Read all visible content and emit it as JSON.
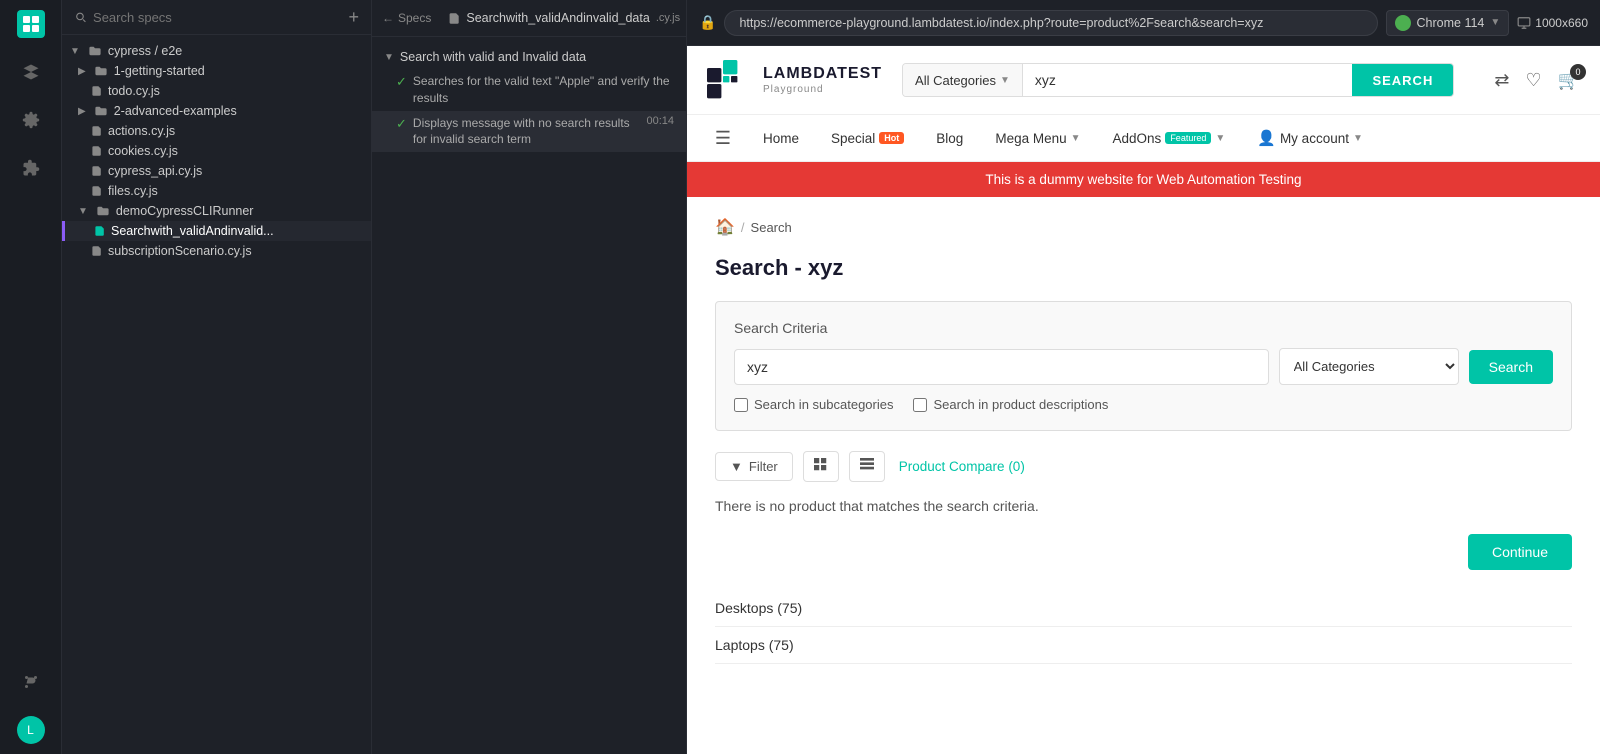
{
  "app": {
    "title": "Search specs"
  },
  "sidebar": {
    "logo_color": "#00c4a7",
    "icons": [
      "grid",
      "layers",
      "settings-cog",
      "settings-cog2"
    ]
  },
  "file_panel": {
    "search_placeholder": "Search specs",
    "tree": {
      "root_folder": "cypress / e2e",
      "folders": [
        {
          "name": "1-getting-started",
          "indent": 1,
          "files": [
            {
              "name": "todo.cy.js",
              "indent": 2
            }
          ]
        },
        {
          "name": "2-advanced-examples",
          "indent": 1,
          "files": [
            {
              "name": "actions.cy.js",
              "indent": 2
            },
            {
              "name": "cookies.cy.js",
              "indent": 2
            },
            {
              "name": "cypress_api.cy.js",
              "indent": 2
            },
            {
              "name": "files.cy.js",
              "indent": 2
            }
          ]
        },
        {
          "name": "demoCypressCLIRunner",
          "indent": 1,
          "files": [
            {
              "name": "Searchwith_validAndinvalid...",
              "indent": 2,
              "active": true
            },
            {
              "name": "subscriptionScenario.cy.js",
              "indent": 2
            }
          ]
        }
      ]
    }
  },
  "spec_panel": {
    "back_label": "Specs",
    "filename": "Searchwith_validAndinvalid_data",
    "extension": ".cy.js",
    "time": "00:14",
    "pass_count": "2",
    "fail_count": "",
    "load_indicator": "○",
    "groups": [
      {
        "name": "Search with valid and Invalid data",
        "tests": [
          {
            "name": "Searches for the valid text \"Apple\" and verify the results",
            "status": "pass"
          },
          {
            "name": "Displays message with no search results for invalid search term",
            "status": "pass",
            "highlighted": true
          }
        ]
      }
    ]
  },
  "browser": {
    "url": "https://ecommerce-playground.lambdatest.io/index.php?route=product%2Fsearch&search=xyz",
    "engine": "Chrome 114",
    "viewport": "1000x660",
    "security_icon": "🔒"
  },
  "website": {
    "logo_brand": "LAMBDATEST",
    "logo_sub": "Playground",
    "search_category": "All Categories",
    "search_value": "xyz",
    "search_button": "SEARCH",
    "nav_items": [
      {
        "label": "Home",
        "badge": null
      },
      {
        "label": "Special",
        "badge": "Hot"
      },
      {
        "label": "Blog",
        "badge": null
      },
      {
        "label": "Mega Menu",
        "badge": null,
        "dropdown": true
      },
      {
        "label": "AddOns",
        "badge": "Featured",
        "dropdown": true
      },
      {
        "label": "My account",
        "badge": null,
        "dropdown": true,
        "icon": "person"
      }
    ],
    "banner_text": "This is a dummy website for Web Automation Testing",
    "breadcrumb": {
      "home_icon": "🏠",
      "separator": "/",
      "current": "Search"
    },
    "page_title": "Search - xyz",
    "search_criteria": {
      "title": "Search Criteria",
      "input_value": "xyz",
      "category_label": "All Categories",
      "search_button": "Search",
      "option_subcategories": "Search in subcategories",
      "option_descriptions": "Search in product descriptions"
    },
    "results": {
      "filter_label": "Filter",
      "compare_label": "Product Compare (0)",
      "no_results_text": "There is no product that matches the search criteria.",
      "continue_button": "Continue"
    },
    "categories": [
      {
        "name": "Desktops (75)"
      },
      {
        "name": "Laptops (75)"
      }
    ]
  }
}
